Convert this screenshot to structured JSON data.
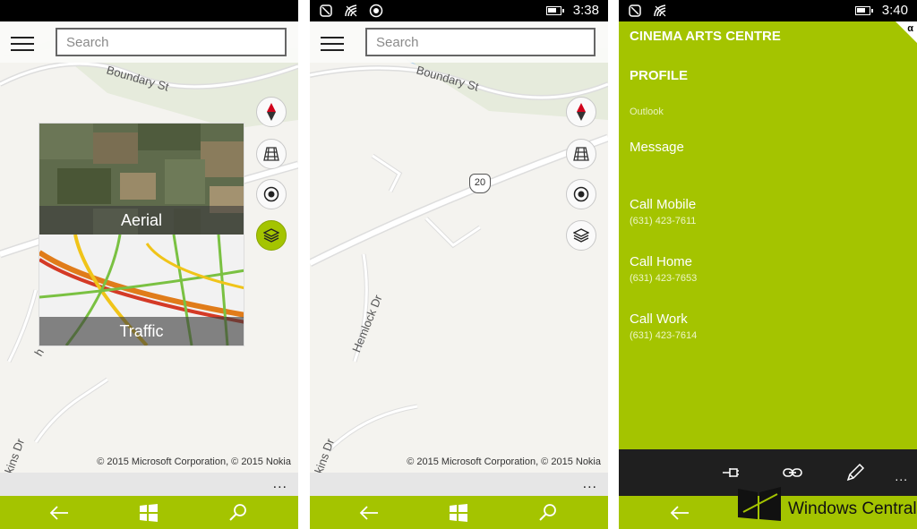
{
  "screen1": {
    "search_placeholder": "Search",
    "road_boundary": "Boundary St",
    "road_partial_kins": "kins Dr",
    "road_partial_h": "h",
    "layer_aerial": "Aerial",
    "layer_traffic": "Traffic",
    "copyright": "© 2015 Microsoft Corporation, © 2015 Nokia",
    "more": "..."
  },
  "screen2": {
    "status_time": "3:38",
    "search_placeholder": "Search",
    "road_boundary": "Boundary St",
    "route_shield": "20",
    "road_hemlock": "Hemlock Dr",
    "road_partial_kins": "kins Dr",
    "copyright": "© 2015 Microsoft Corporation, © 2015 Nokia",
    "more": "..."
  },
  "screen3": {
    "status_time": "3:40",
    "title": "CINEMA ARTS CENTRE",
    "section": "PROFILE",
    "account": "Outlook",
    "message_label": "Message",
    "actions": [
      {
        "label": "Call Mobile",
        "phone": "(631) 423-7611"
      },
      {
        "label": "Call Home",
        "phone": "(631) 423-7653"
      },
      {
        "label": "Call Work",
        "phone": "(631) 423-7614"
      }
    ],
    "corner_mark": "α",
    "more": "..."
  },
  "watermark": "Windows Central",
  "colors": {
    "accent": "#a4c400",
    "map_bg": "#f4f3ef",
    "appbar_bg": "#1f1f1f"
  },
  "icons": [
    "hamburger-icon",
    "compass-icon",
    "grid-view-icon",
    "locate-icon",
    "layers-icon",
    "back-icon",
    "windows-icon",
    "search-icon",
    "pin-icon",
    "link-icon",
    "edit-icon"
  ]
}
